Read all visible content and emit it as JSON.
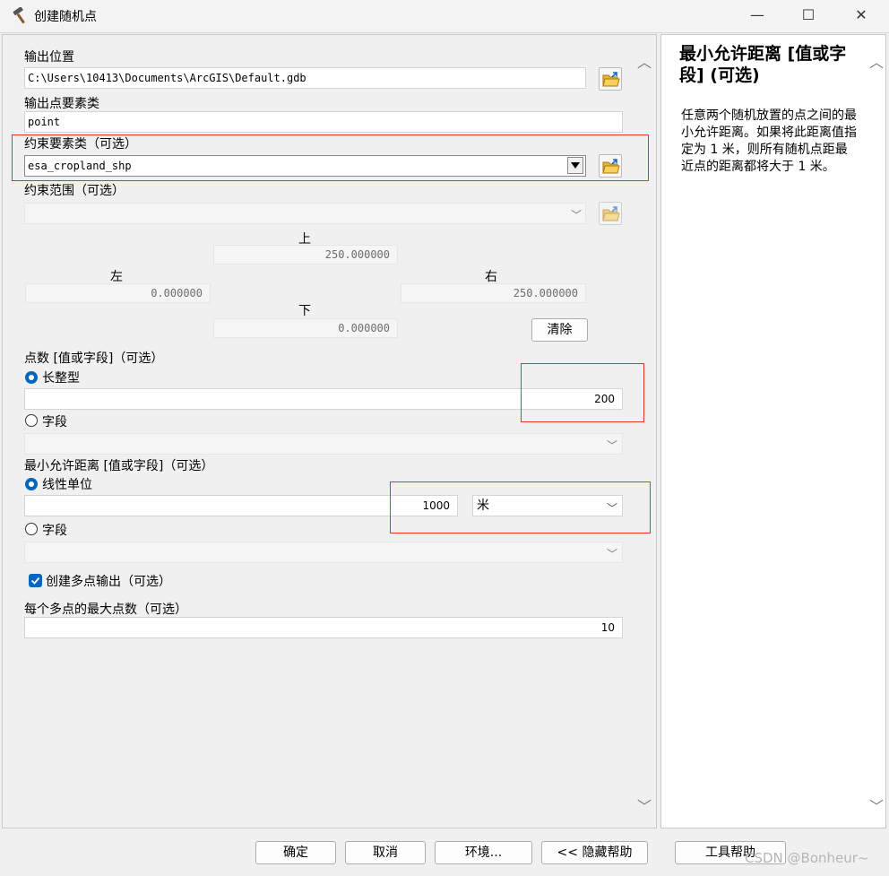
{
  "window": {
    "title": "创建随机点",
    "icon": "hammer-icon",
    "controls": {
      "minimize": "—",
      "maximize": "☐",
      "close": "✕"
    }
  },
  "form": {
    "output_location": {
      "label": "输出位置",
      "value": "C:\\Users\\10413\\Documents\\ArcGIS\\Default.gdb"
    },
    "output_feature_class": {
      "label": "输出点要素类",
      "value": "point"
    },
    "constraint_feature_class": {
      "label": "约束要素类（可选）",
      "value": "esa_cropland_shp"
    },
    "constraint_extent": {
      "label": "约束范围（可选）",
      "value": "",
      "top_label": "上",
      "top_value": "250.000000",
      "left_label": "左",
      "left_value": "0.000000",
      "right_label": "右",
      "right_value": "250.000000",
      "bottom_label": "下",
      "bottom_value": "0.000000",
      "clear_button": "清除"
    },
    "number_of_points": {
      "label": "点数 [值或字段]（可选）",
      "long_option": "长整型",
      "long_selected": true,
      "long_value": "200",
      "field_option": "字段",
      "field_value": ""
    },
    "min_distance": {
      "label": "最小允许距离 [值或字段]（可选）",
      "linear_option": "线性单位",
      "linear_selected": true,
      "distance_value": "1000",
      "unit_value": "米",
      "field_option": "字段",
      "field_value": ""
    },
    "create_multipoint": {
      "label": "创建多点输出（可选）",
      "checked": true
    },
    "max_points_per_multipoint": {
      "label": "每个多点的最大点数（可选）",
      "value": "10"
    }
  },
  "help_panel": {
    "title": "最小允许距离 [值或字段] (可选)",
    "body": "任意两个随机放置的点之间的最小允许距离。如果将此距离值指定为 1 米，则所有随机点距最近点的距离都将大于 1 米。"
  },
  "buttons": {
    "ok": "确定",
    "cancel": "取消",
    "environments": "环境...",
    "hide_help": "<< 隐藏帮助",
    "tool_help": "工具帮助"
  },
  "watermark": "CSDN @Bonheur~",
  "colors": {
    "accent": "#0067c0",
    "highlight_box": "#e0352b"
  }
}
